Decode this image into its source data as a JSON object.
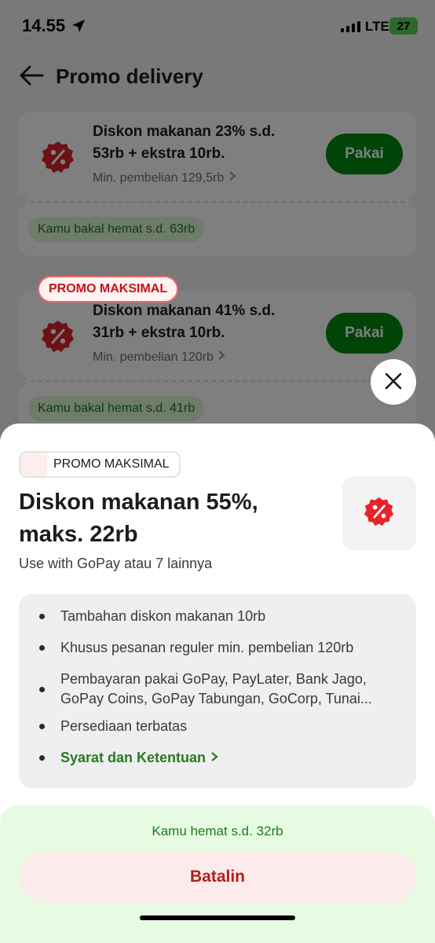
{
  "status_bar": {
    "time": "14.55",
    "network": "LTE",
    "battery": "27"
  },
  "header": {
    "title": "Promo delivery"
  },
  "promos": [
    {
      "title": "Diskon makanan 23% s.d. 53rb + ekstra 10rb.",
      "min_purchase": "Min. pembelian 129,5rb",
      "button_label": "Pakai",
      "savings": "Kamu bakal hemat s.d. 63rb"
    },
    {
      "badge": "PROMO MAKSIMAL",
      "title": "Diskon makanan 41% s.d. 31rb + ekstra 10rb.",
      "min_purchase": "Min. pembelian 120rb",
      "button_label": "Pakai",
      "savings": "Kamu bakal hemat s.d. 41rb"
    }
  ],
  "sheet": {
    "badge": "PROMO MAKSIMAL",
    "title": "Diskon makanan 55%, maks. 22rb",
    "subtitle": "Use with GoPay atau 7 lainnya",
    "details": [
      "Tambahan diskon makanan 10rb",
      "Khusus pesanan reguler min. pembelian 120rb",
      "Pembayaran pakai GoPay, PayLater, Bank Jago, GoPay Coins, GoPay Tabungan, GoCorp, Tunai...",
      "Persediaan terbatas"
    ],
    "terms_link": "Syarat dan Ketentuan",
    "footer_savings": "Kamu hemat s.d. 32rb",
    "cancel_label": "Batalin"
  },
  "colors": {
    "brand_green": "#00880f",
    "promo_red": "#d9232a",
    "cancel_red": "#b71c1c",
    "footer_bg": "#e7fbe2"
  }
}
